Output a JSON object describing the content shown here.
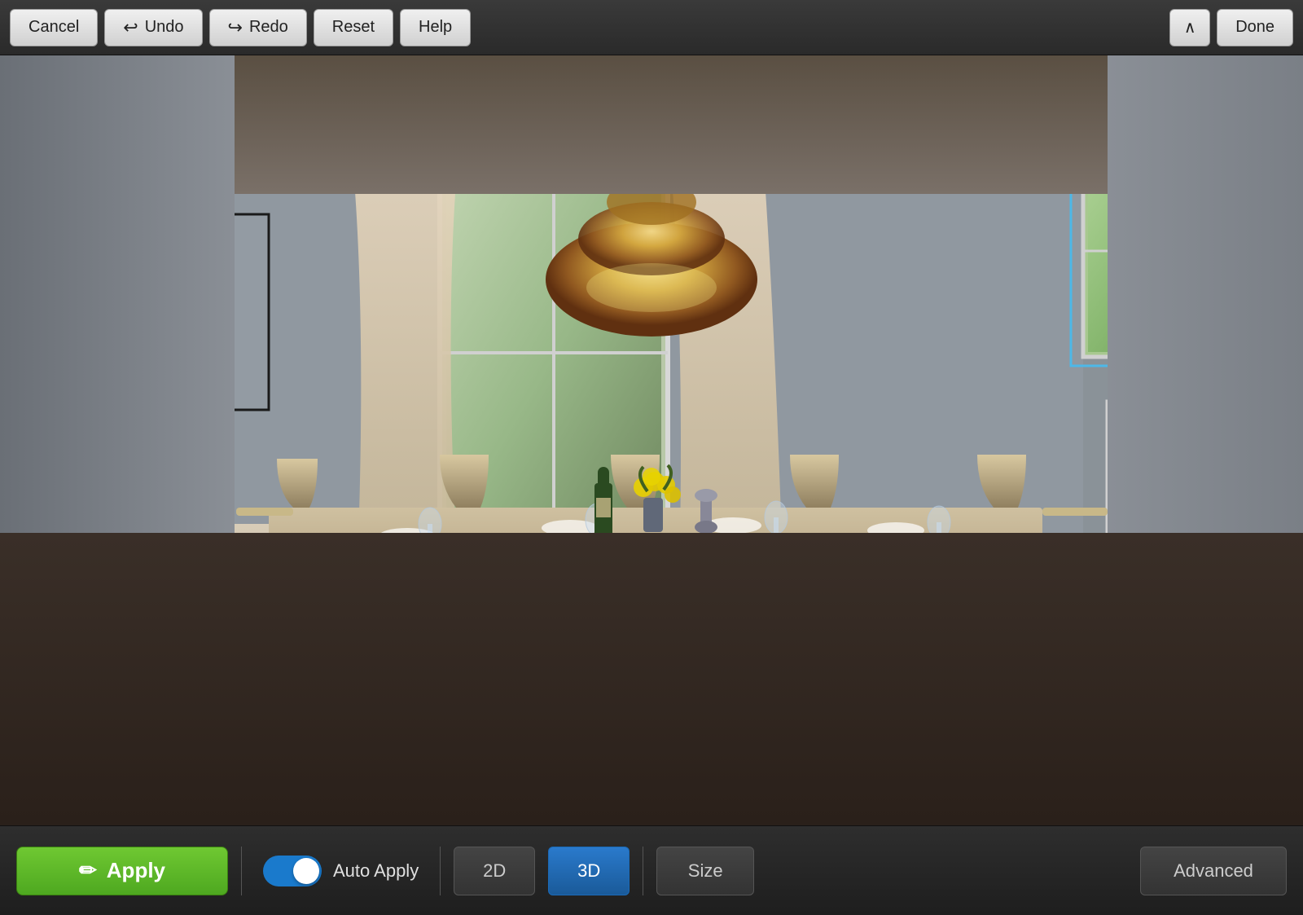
{
  "toolbar": {
    "cancel_label": "Cancel",
    "undo_label": "Undo",
    "redo_label": "Redo",
    "reset_label": "Reset",
    "help_label": "Help",
    "done_label": "Done"
  },
  "bottom_toolbar": {
    "apply_label": "Apply",
    "auto_apply_label": "Auto Apply",
    "view_2d_label": "2D",
    "view_3d_label": "3D",
    "size_label": "Size",
    "advanced_label": "Advanced",
    "toggle_on": true,
    "active_view": "3D"
  },
  "icons": {
    "undo_icon": "↩",
    "redo_icon": "↪",
    "collapse_icon": "∧",
    "paint_icon": "✏"
  }
}
